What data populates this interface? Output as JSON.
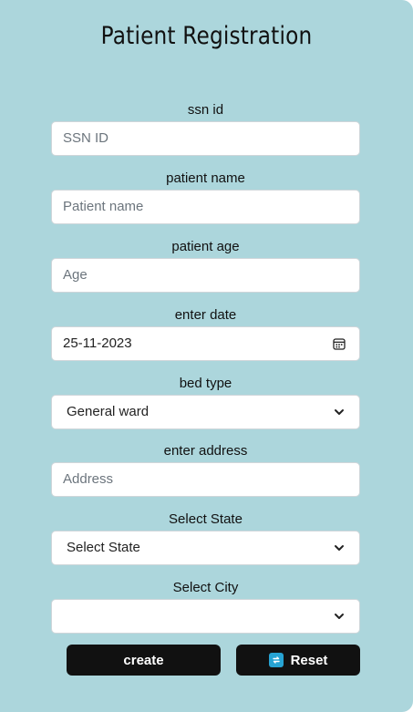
{
  "form": {
    "title": "Patient Registration",
    "fields": [
      {
        "label": "ssn id",
        "placeholder": "SSN ID",
        "value": ""
      },
      {
        "label": "patient name",
        "placeholder": "Patient name",
        "value": ""
      },
      {
        "label": "patient age",
        "placeholder": "Age",
        "value": ""
      },
      {
        "label": "enter date",
        "value": "25-11-2023"
      },
      {
        "label": "bed type",
        "value": "General ward"
      },
      {
        "label": "enter address",
        "placeholder": "Address",
        "value": ""
      },
      {
        "label": "Select State",
        "value": "Select State"
      },
      {
        "label": "Select City",
        "value": ""
      }
    ],
    "buttons": {
      "create": "create",
      "reset": "Reset"
    }
  }
}
